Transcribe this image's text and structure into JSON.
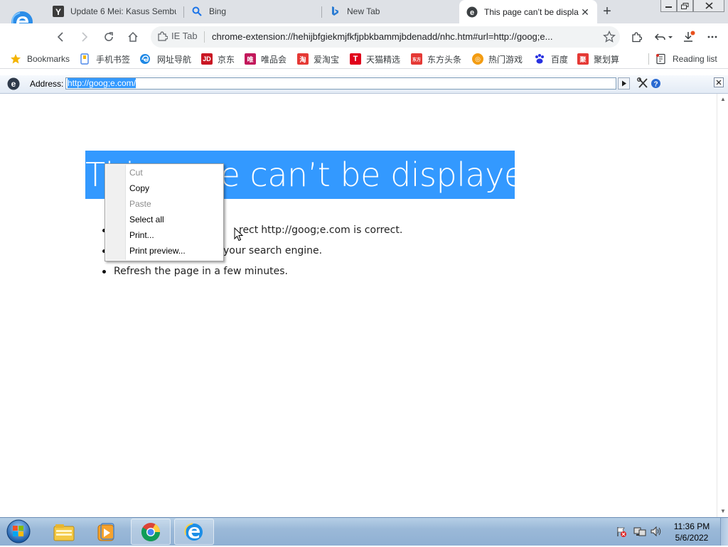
{
  "tabs": [
    {
      "title": "Update 6 Mei: Kasus Sembu",
      "icon": "yahoo-icon"
    },
    {
      "title": "Bing",
      "icon": "search-icon"
    },
    {
      "title": "New Tab",
      "icon": "bing-icon"
    },
    {
      "title": "This page can’t be displa",
      "icon": "ie-icon",
      "active": true
    }
  ],
  "toolbar": {
    "ietab_label": "IE Tab",
    "url": "chrome-extension://hehijbfgiekmjfkfjpbkbammjbdenadd/nhc.htm#url=http://goog;e..."
  },
  "bookmarks": [
    {
      "label": "Bookmarks",
      "icon": "star-icon",
      "color": "#f4b400"
    },
    {
      "label": "手机书签",
      "icon": "phone-bookmark-icon",
      "color": "#4a86e8"
    },
    {
      "label": "网址导航",
      "icon": "edge-icon",
      "color": "#1e88e5"
    },
    {
      "label": "京东",
      "icon": "jd-icon",
      "color": "#c91623",
      "glyph": "JD"
    },
    {
      "label": "唯品会",
      "icon": "vip-icon",
      "color": "#c2185b",
      "glyph": "唯"
    },
    {
      "label": "爱淘宝",
      "icon": "taobao-icon",
      "color": "#e53935",
      "glyph": "淘"
    },
    {
      "label": "天猫精选",
      "icon": "tmall-icon",
      "color": "#e0001b",
      "glyph": "T"
    },
    {
      "label": "东方头条",
      "icon": "dongfang-icon",
      "color": "#e53935",
      "glyph": "东方"
    },
    {
      "label": "热门游戏",
      "icon": "game-icon",
      "color": "#f39c12",
      "glyph": "◎"
    },
    {
      "label": "百度",
      "icon": "baidu-icon",
      "color": "#2932e1",
      "glyph": "🐾"
    },
    {
      "label": "聚划算",
      "icon": "juhuasuan-icon",
      "color": "#e53935",
      "glyph": "聚"
    }
  ],
  "reading_list": "Reading list",
  "ie_bar": {
    "address_label": "Address:",
    "address_value": "http://goog;e.com/"
  },
  "page": {
    "title": "This page can’t be displayed",
    "bullets": [
      "Make sure the web address http://goog;e.com is correct.",
      "Look for the page with your search engine.",
      "Refresh the page in a few minutes."
    ],
    "bullets_visible": [
      "http://goog;e.com is correct.",
      "your search engine.",
      "Refresh the page in a few minutes."
    ],
    "bullet_partial_prefix": "rect"
  },
  "context_menu": [
    {
      "label": "Cut",
      "enabled": false
    },
    {
      "label": "Copy",
      "enabled": true
    },
    {
      "label": "Paste",
      "enabled": false
    },
    {
      "label": "Select all",
      "enabled": true
    },
    {
      "label": "Print...",
      "enabled": true
    },
    {
      "label": "Print preview...",
      "enabled": true
    }
  ],
  "taskbar": {
    "time": "11:36 PM",
    "date": "5/6/2022",
    "apps": [
      "explorer-icon",
      "media-player-icon",
      "chrome-icon",
      "ie-icon"
    ]
  },
  "colors": {
    "selection": "#3399ff",
    "tabstrip": "#dee1e6"
  }
}
